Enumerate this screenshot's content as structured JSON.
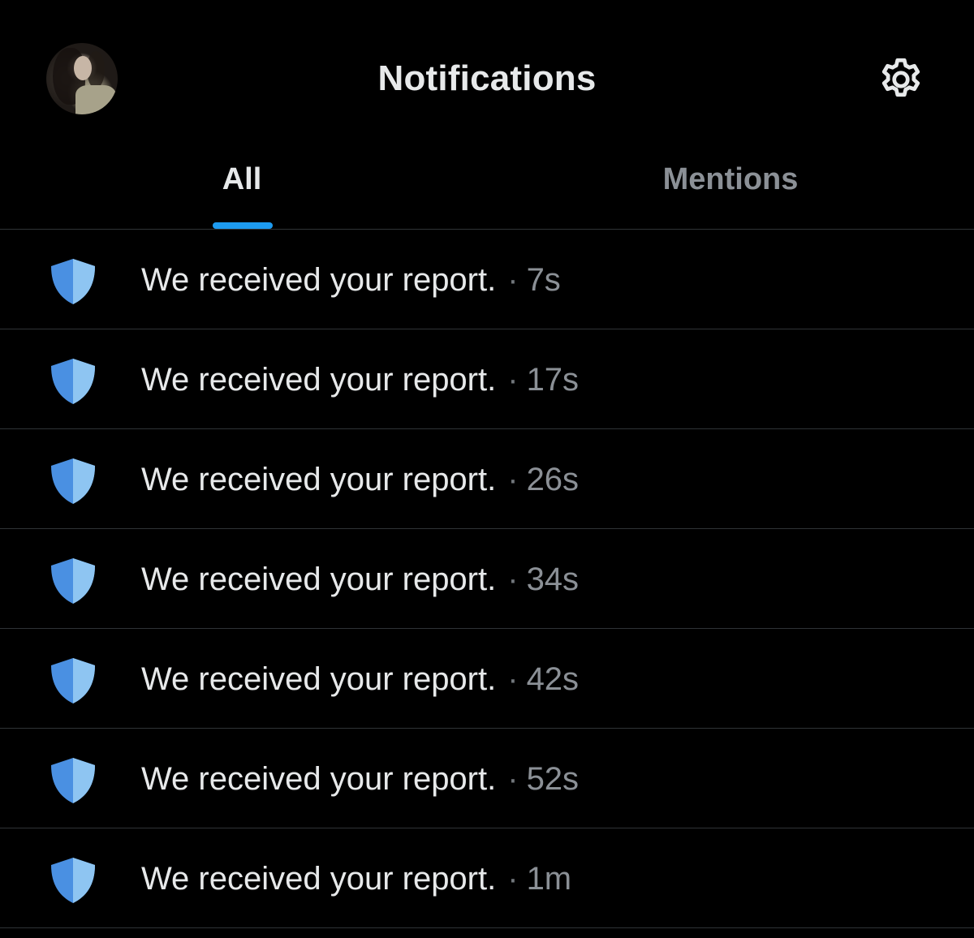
{
  "header": {
    "title": "Notifications",
    "avatar_icon": "avatar-photo",
    "settings_icon": "gear-icon"
  },
  "tabs": [
    {
      "label": "All",
      "selected": true
    },
    {
      "label": "Mentions",
      "selected": false
    }
  ],
  "colors": {
    "background": "#000000",
    "accent": "#1d9bf0",
    "shield_dark": "#4a90e2",
    "shield_light": "#8ec5f2",
    "text_primary": "#e7e9ea",
    "text_secondary": "#8b9096"
  },
  "notifications": [
    {
      "icon": "shield-icon",
      "message": "We received your report.",
      "separator": "·",
      "time": "7s"
    },
    {
      "icon": "shield-icon",
      "message": "We received your report.",
      "separator": "·",
      "time": "17s"
    },
    {
      "icon": "shield-icon",
      "message": "We received your report.",
      "separator": "·",
      "time": "26s"
    },
    {
      "icon": "shield-icon",
      "message": "We received your report.",
      "separator": "·",
      "time": "34s"
    },
    {
      "icon": "shield-icon",
      "message": "We received your report.",
      "separator": "·",
      "time": "42s"
    },
    {
      "icon": "shield-icon",
      "message": "We received your report.",
      "separator": "·",
      "time": "52s"
    },
    {
      "icon": "shield-icon",
      "message": "We received your report.",
      "separator": "·",
      "time": "1m"
    }
  ]
}
